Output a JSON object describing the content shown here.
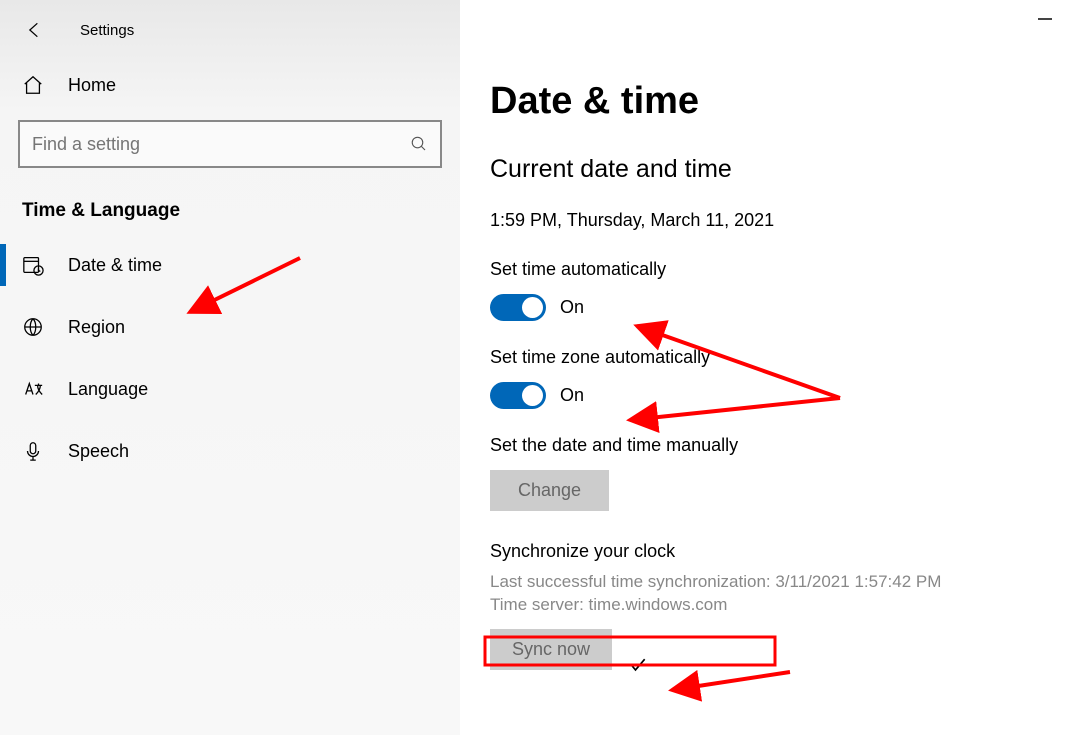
{
  "header": {
    "app_title": "Settings"
  },
  "sidebar": {
    "home_label": "Home",
    "search_placeholder": "Find a setting",
    "category": "Time & Language",
    "items": [
      {
        "label": "Date & time",
        "icon": "calendar-clock-icon",
        "active": true
      },
      {
        "label": "Region",
        "icon": "globe-icon",
        "active": false
      },
      {
        "label": "Language",
        "icon": "language-icon",
        "active": false
      },
      {
        "label": "Speech",
        "icon": "microphone-icon",
        "active": false
      }
    ]
  },
  "main": {
    "title": "Date & time",
    "current_heading": "Current date and time",
    "current_value": "1:59 PM, Thursday, March 11, 2021",
    "set_time_auto_label": "Set time automatically",
    "set_time_auto_state": "On",
    "set_tz_auto_label": "Set time zone automatically",
    "set_tz_auto_state": "On",
    "set_manual_label": "Set the date and time manually",
    "change_button": "Change",
    "sync_heading": "Synchronize your clock",
    "last_sync": "Last successful time synchronization: 3/11/2021 1:57:42 PM",
    "time_server": "Time server: time.windows.com",
    "sync_button": "Sync now"
  }
}
